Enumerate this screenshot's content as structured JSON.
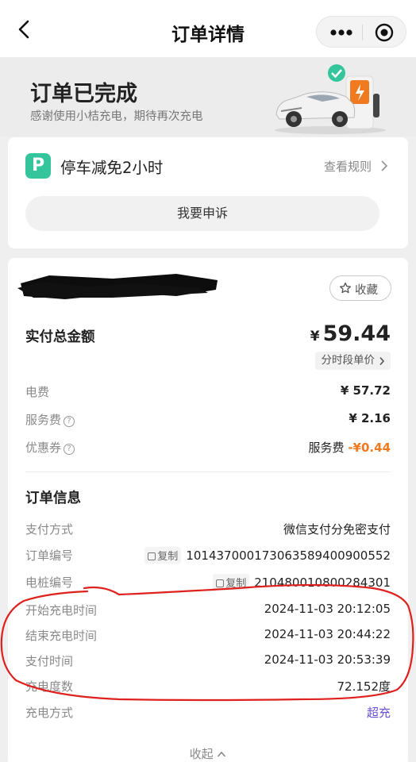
{
  "header": {
    "title": "订单详情"
  },
  "banner": {
    "status": "订单已完成",
    "thanks": "感谢使用小桔充电，期待再次充电"
  },
  "parking": {
    "icon_letter": "P",
    "title": "停车减免2小时",
    "rules_link": "查看规则",
    "appeal_button": "我要申诉"
  },
  "station": {
    "favorite_label": "收藏"
  },
  "payment": {
    "total_label": "实付总金额",
    "currency": "¥",
    "total_value": "59.44",
    "tod_price_label": "分时段单价",
    "lines": [
      {
        "label": "电费",
        "value": "¥ 57.72"
      },
      {
        "label": "服务费",
        "value": "¥ 2.16"
      },
      {
        "label": "优惠券",
        "prefix": "服务费",
        "value": "-¥0.44"
      }
    ]
  },
  "order_info": {
    "title": "订单信息",
    "copy_label": "复制",
    "rows": [
      {
        "label": "支付方式",
        "value": "微信支付分免密支付"
      },
      {
        "label": "订单编号",
        "value": "1014370001730635894009005​52"
      },
      {
        "label": "电桩编号",
        "value": "210480010800284301"
      },
      {
        "label": "开始充电时间",
        "value": "2024-11-03 20:12:05"
      },
      {
        "label": "结束充电时间",
        "value": "2024-11-03 20:44:22"
      },
      {
        "label": "支付时间",
        "value": "2024-11-03 20:53:39"
      },
      {
        "label": "充电度数",
        "value": "72.152度"
      },
      {
        "label": "充电方式",
        "value": "超充"
      }
    ],
    "collapse_label": "收起"
  },
  "colors": {
    "accent_green": "#35c59c",
    "discount_orange": "#f07a20",
    "link_purple": "#6b4fd6",
    "annotation_red": "#e0201d"
  },
  "icons": [
    "back-arrow-icon",
    "more-dots-icon",
    "close-target-icon",
    "ev-car-charger-illustration",
    "parking-p-icon",
    "chevron-right-icon",
    "star-icon",
    "help-circle-icon",
    "copy-icon",
    "chevron-up-icon"
  ]
}
